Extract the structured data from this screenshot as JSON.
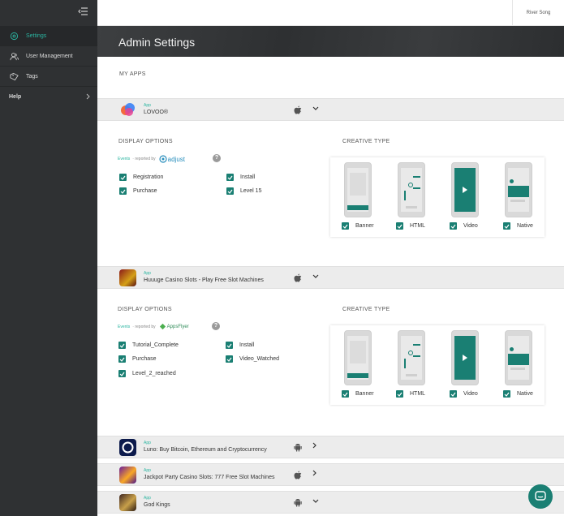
{
  "user": {
    "name": "River Song"
  },
  "sidebar": {
    "items": [
      {
        "label": "Settings",
        "icon": "gear-icon"
      },
      {
        "label": "User Management",
        "icon": "users-icon"
      },
      {
        "label": "Tags",
        "icon": "tag-icon"
      },
      {
        "label": "Help",
        "icon": "chevron-right-icon"
      }
    ]
  },
  "page": {
    "title": "Admin Settings",
    "section": "MY APPS"
  },
  "apps": [
    {
      "kind": "App",
      "name": "LOVOO®",
      "os": "apple",
      "expanded": true,
      "display_options_title": "DISPLAY OPTIONS",
      "events_label": "Events",
      "reported_by": "· reported by",
      "attribution": "adjust",
      "events": [
        "Registration",
        "Install",
        "Purchase",
        "Level 15"
      ],
      "creative_title": "CREATIVE TYPE",
      "creatives": [
        "Banner",
        "HTML",
        "Video",
        "Native"
      ]
    },
    {
      "kind": "App",
      "name": "Huuuge Casino Slots - Play Free Slot Machines",
      "os": "apple",
      "expanded": true,
      "display_options_title": "DISPLAY OPTIONS",
      "events_label": "Events",
      "reported_by": "· reported by",
      "attribution": "AppsFlyer",
      "events": [
        "Tutorial_Complete",
        "Install",
        "Purchase",
        "Video_Watched",
        "Level_2_reached"
      ],
      "creative_title": "CREATIVE TYPE",
      "creatives": [
        "Banner",
        "HTML",
        "Video",
        "Native"
      ]
    },
    {
      "kind": "App",
      "name": "Luno: Buy Bitcoin, Ethereum and Cryptocurrency",
      "os": "android",
      "expanded": false
    },
    {
      "kind": "App",
      "name": "Jackpot Party Casino Slots: 777 Free Slot Machines",
      "os": "apple",
      "expanded": false
    },
    {
      "kind": "App",
      "name": "God Kings",
      "os": "android",
      "expanded": true
    }
  ],
  "colors": {
    "accent": "#2bb5a1",
    "checkbox": "#1a7f73",
    "sidebar": "#2f3133"
  }
}
